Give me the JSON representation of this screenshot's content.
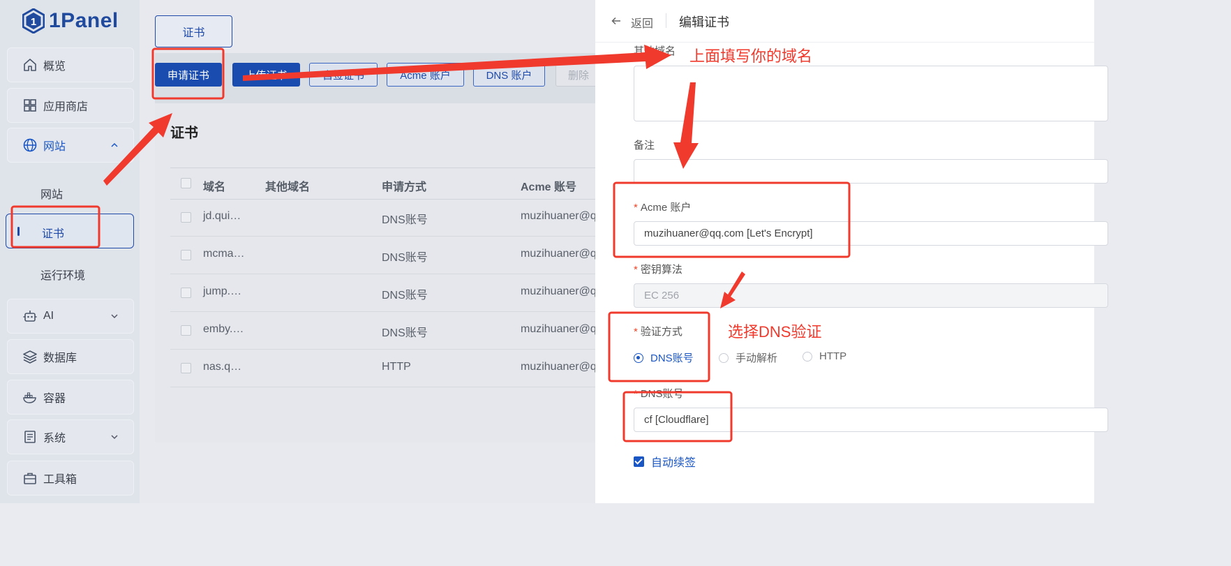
{
  "logo": {
    "text": "1Panel"
  },
  "sidebar": {
    "items": [
      {
        "label": "概览",
        "icon": "home-icon"
      },
      {
        "label": "应用商店",
        "icon": "grid-icon"
      },
      {
        "label": "网站",
        "icon": "globe-icon"
      },
      {
        "label": "AI",
        "icon": "robot-icon"
      },
      {
        "label": "数据库",
        "icon": "layers-icon"
      },
      {
        "label": "容器",
        "icon": "docker-icon"
      },
      {
        "label": "系统",
        "icon": "server-icon"
      },
      {
        "label": "工具箱",
        "icon": "toolbox-icon"
      }
    ],
    "website_sub": [
      "网站",
      "证书",
      "运行环境"
    ]
  },
  "main": {
    "tab_label": "证书",
    "toolbar": [
      "申请证书",
      "上传证书",
      "自签证书",
      "Acme 账户",
      "DNS 账户",
      "删除"
    ],
    "title": "证书",
    "columns": [
      "域名",
      "其他域名",
      "申请方式",
      "Acme 账号"
    ],
    "rows": [
      {
        "domain": "jd.qui…",
        "other": "",
        "method": "DNS账号",
        "acme": "muzihuaner@qq"
      },
      {
        "domain": "mcma…",
        "other": "",
        "method": "DNS账号",
        "acme": "muzihuaner@qq"
      },
      {
        "domain": "jump.…",
        "other": "",
        "method": "DNS账号",
        "acme": "muzihuaner@qq"
      },
      {
        "domain": "emby.…",
        "other": "",
        "method": "DNS账号",
        "acme": "muzihuaner@qq"
      },
      {
        "domain": "nas.q…",
        "other": "",
        "method": "HTTP",
        "acme": "muzihuaner@qq"
      }
    ]
  },
  "drawer": {
    "back": "返回",
    "title": "编辑证书",
    "other_domains_label": "其他域名",
    "remark_label": "备注",
    "acme_label": "Acme 账户",
    "acme_value": "muzihuaner@qq.com [Let's Encrypt]",
    "key_label": "密钥算法",
    "key_value": "EC 256",
    "verify_label": "验证方式",
    "verify_options": [
      "DNS账号",
      "手动解析",
      "HTTP"
    ],
    "dns_label": "DNS账号",
    "dns_value": "cf [Cloudflare]",
    "auto_renew": "自动续签"
  },
  "annotations": {
    "domain_hint": "上面填写你的域名",
    "dns_hint": "选择DNS验证"
  },
  "colors": {
    "accent": "#1a56c4",
    "annotation": "#f03a2e"
  }
}
